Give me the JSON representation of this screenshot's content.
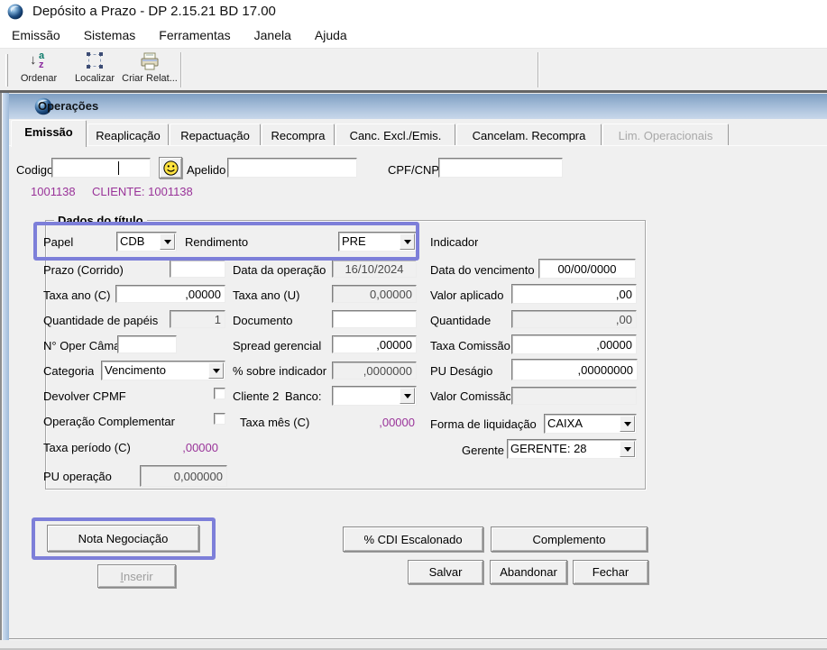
{
  "window": {
    "title": "Depósito a Prazo - DP 2.15.21 BD 17.00",
    "icon": "sphere-logo"
  },
  "menu": {
    "items": [
      "Emissão",
      "Sistemas",
      "Ferramentas",
      "Janela",
      "Ajuda"
    ]
  },
  "toolbar": {
    "buttons": [
      {
        "label": "Ordenar",
        "icon": "sort-az-icon"
      },
      {
        "label": "Localizar",
        "icon": "locate-icon"
      },
      {
        "label": "Criar Relat...",
        "icon": "printer-icon"
      }
    ]
  },
  "operations_window": {
    "title": "Operações",
    "icon": "sphere-logo"
  },
  "tabs": [
    {
      "label": "Emissão",
      "state": "active"
    },
    {
      "label": "Reaplicação",
      "state": "normal"
    },
    {
      "label": "Repactuação",
      "state": "normal"
    },
    {
      "label": "Recompra",
      "state": "normal"
    },
    {
      "label": "Canc. Excl./Emis.",
      "state": "normal"
    },
    {
      "label": "Cancelam. Recompra",
      "state": "normal"
    },
    {
      "label": "Lim. Operacionais",
      "state": "disabled"
    }
  ],
  "header": {
    "codigo": {
      "label": "Codigo",
      "value": ""
    },
    "smiley_button_icon": "smiley-icon",
    "apelido": {
      "label": "Apelido",
      "value": ""
    },
    "cpf_cnpj": {
      "label": "CPF/CNPJ",
      "value": ""
    }
  },
  "client_line": {
    "code": "1001138",
    "text": "CLIENTE: 1001138"
  },
  "group": {
    "title": "Dados do título"
  },
  "form": {
    "papel": {
      "label": "Papel",
      "value": "CDB"
    },
    "rendimento": {
      "label": "Rendimento",
      "value": "PRE"
    },
    "indicador": {
      "label": "Indicador"
    },
    "prazo_corrido": {
      "label": "Prazo (Corrido)",
      "value": ""
    },
    "data_operacao": {
      "label": "Data da operação",
      "value": "16/10/2024"
    },
    "data_vencimento": {
      "label": "Data do vencimento",
      "value": "00/00/0000"
    },
    "taxa_ano_c": {
      "label": "Taxa ano (C)",
      "value": ",00000"
    },
    "taxa_ano_u": {
      "label": "Taxa ano (U)",
      "value": "0,00000"
    },
    "valor_aplicado": {
      "label": "Valor aplicado",
      "value": ",00"
    },
    "qtd_papeis": {
      "label": "Quantidade de papéis",
      "value": "1"
    },
    "documento": {
      "label": "Documento",
      "value": ""
    },
    "quantidade": {
      "label": "Quantidade",
      "value": ",00"
    },
    "n_oper_camara": {
      "label": "N° Oper Câmara",
      "value": ""
    },
    "spread_gerencial": {
      "label": "Spread gerencial",
      "value": ",00000"
    },
    "taxa_comissao": {
      "label": "Taxa Comissão",
      "value": ",00000"
    },
    "categoria": {
      "label": "Categoria",
      "value": "Vencimento"
    },
    "pct_sobre_indicador": {
      "label": "% sobre indicador",
      "value": ",0000000"
    },
    "pu_desagio": {
      "label": "PU Deságio",
      "value": ",00000000"
    },
    "devolver_cpmf": {
      "label": "Devolver CPMF",
      "checked": false
    },
    "cliente2": {
      "label": "Cliente 2"
    },
    "banco": {
      "label": "Banco:",
      "value": ""
    },
    "valor_comissao": {
      "label": "Valor Comissão",
      "value": ""
    },
    "operacao_complementar": {
      "label": "Operação Complementar",
      "checked": false
    },
    "taxa_mes_c": {
      "label": "Taxa mês (C)",
      "value": ",00000"
    },
    "forma_liquidacao": {
      "label": "Forma de liquidação",
      "value": "CAIXA"
    },
    "taxa_periodo_c": {
      "label": "Taxa período (C)",
      "value": ",00000"
    },
    "gerente": {
      "label": "Gerente",
      "value": "GERENTE: 28"
    },
    "pu_operacao": {
      "label": "PU operação",
      "value": "0,000000"
    }
  },
  "buttons": {
    "nota": "Nota Negociação",
    "inserir": "Inserir",
    "cdi": "% CDI Escalonado",
    "complemento": "Complemento",
    "salvar": "Salvar",
    "abandonar": "Abandonar",
    "fechar": "Fechar"
  },
  "colors": {
    "annotation_highlight": "#7d7fd9",
    "client_text": "#993399",
    "child_titlebar_top": "#7f9fc2",
    "child_titlebar_bottom": "#c9d8ea"
  }
}
